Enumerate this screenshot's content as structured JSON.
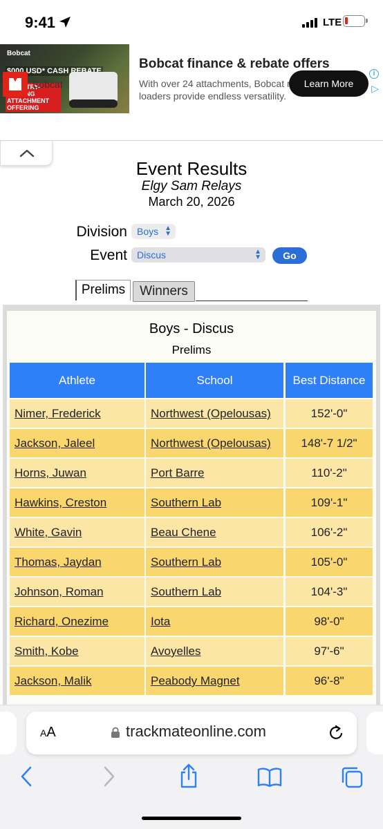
{
  "status_bar": {
    "time": "9:41",
    "network": "LTE"
  },
  "ad": {
    "image_brand": "Bobcat",
    "image_line1": "$000 USD* CASH REBATE",
    "image_line2": "INDUSTRY-LEADING ATTACHMENT OFFERING",
    "title": "Bobcat finance & rebate offers",
    "description": "With over 24 attachments, Bobcat mini track loaders provide endless versatility.",
    "brand": "Bobcat",
    "cta": "Learn More",
    "accent_color": "#e2231a"
  },
  "header": {
    "title": "Event Results",
    "meet": "Elgy Sam Relays",
    "date": "March 20, 2026"
  },
  "filters": {
    "division_label": "Division",
    "division_value": "Boys",
    "event_label": "Event",
    "event_value": "Discus",
    "go_label": "Go"
  },
  "tabs": [
    {
      "label": "Prelims",
      "active": true
    },
    {
      "label": "Winners",
      "active": false
    }
  ],
  "results": {
    "title": "Boys - Discus",
    "subtitle": "Prelims",
    "columns": [
      "Athlete",
      "School",
      "Best Distance"
    ],
    "rows": [
      {
        "athlete": "Nimer, Frederick",
        "school": "Northwest (Opelousas)",
        "best": "152'-0\""
      },
      {
        "athlete": "Jackson, Jaleel",
        "school": "Northwest (Opelousas)",
        "best": "148'-7 1/2\""
      },
      {
        "athlete": "Horns, Juwan",
        "school": "Port Barre",
        "best": "110'-2\""
      },
      {
        "athlete": "Hawkins, Creston",
        "school": "Southern Lab",
        "best": "109'-1\""
      },
      {
        "athlete": "White, Gavin",
        "school": "Beau Chene",
        "best": "106'-2\""
      },
      {
        "athlete": "Thomas, Jaydan",
        "school": "Southern Lab",
        "best": "105'-0\""
      },
      {
        "athlete": "Johnson, Roman",
        "school": "Southern Lab",
        "best": "104'-3\""
      },
      {
        "athlete": "Richard, Onezime",
        "school": "Iota",
        "best": "98'-0\""
      },
      {
        "athlete": "Smith, Kobe",
        "school": "Avoyelles",
        "best": "97'-6\""
      },
      {
        "athlete": "Jackson, Malik",
        "school": "Peabody Magnet",
        "best": "96'-8\""
      }
    ],
    "header_color": "#2f7ff7",
    "row_color_a": "#fbe6a6",
    "row_color_b": "#f9d76e"
  },
  "browser": {
    "text_size_label": "AA",
    "url": "trackmateonline.com",
    "icons": [
      "back-icon",
      "forward-icon",
      "share-icon",
      "bookmarks-icon",
      "tabs-icon"
    ]
  }
}
